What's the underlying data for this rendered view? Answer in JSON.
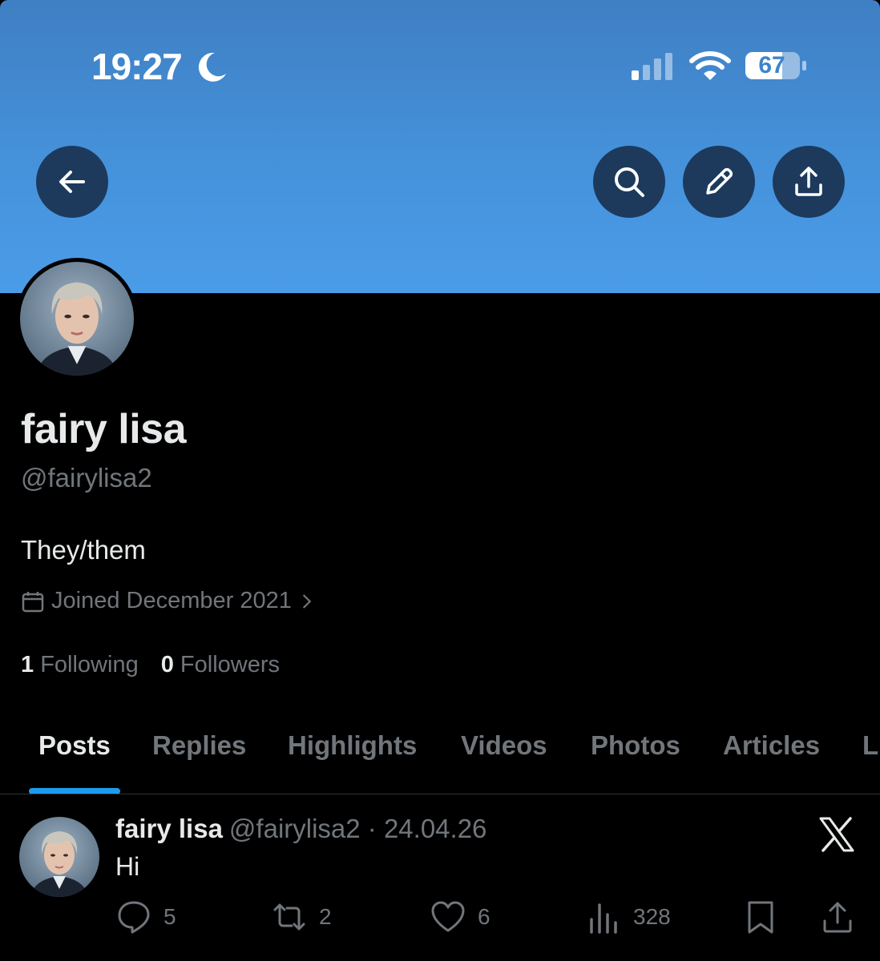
{
  "status_bar": {
    "time": "19:27",
    "battery": "67"
  },
  "header": {
    "back_icon": "arrow-left-icon",
    "search_icon": "search-icon",
    "edit_icon": "pencil-icon",
    "share_icon": "upload-icon"
  },
  "profile": {
    "display_name": "fairy lisa",
    "handle": "@fairylisa2",
    "bio": "They/them",
    "joined": "Joined December 2021",
    "following_count": "1",
    "following_label": "Following",
    "followers_count": "0",
    "followers_label": "Followers"
  },
  "tabs": [
    {
      "label": "Posts",
      "active": true
    },
    {
      "label": "Replies"
    },
    {
      "label": "Highlights"
    },
    {
      "label": "Videos"
    },
    {
      "label": "Photos"
    },
    {
      "label": "Articles"
    },
    {
      "label": "Li"
    }
  ],
  "post": {
    "name": "fairy lisa",
    "meta": "@fairylisa2 · 24.04.26",
    "text": "Hi",
    "replies": "5",
    "reposts": "2",
    "likes": "6",
    "views": "328"
  },
  "colors": {
    "banner": "#4592db",
    "button_bg": "#1d3a5c",
    "accent": "#1d9bf0",
    "muted": "#71767b",
    "text": "#e7e9ea"
  }
}
